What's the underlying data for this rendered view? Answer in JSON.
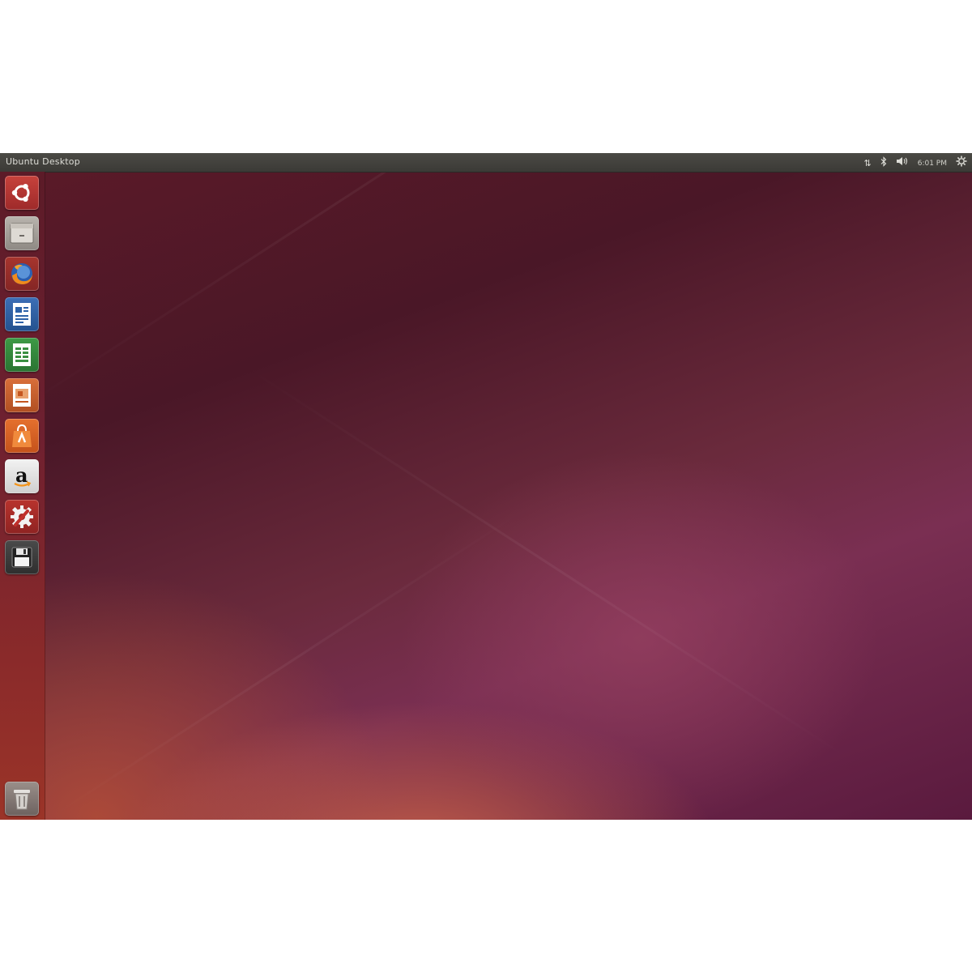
{
  "topbar": {
    "title": "Ubuntu Desktop",
    "indicators": {
      "network_icon": "network-arrows-icon",
      "bluetooth_icon": "bluetooth-icon",
      "volume_icon": "volume-icon",
      "clock": "6:01 PM",
      "session_icon": "gear-power-icon"
    }
  },
  "launcher": {
    "items": [
      {
        "name": "dash-home",
        "icon": "ubuntu-logo-icon"
      },
      {
        "name": "files",
        "icon": "file-manager-icon"
      },
      {
        "name": "firefox",
        "icon": "firefox-icon"
      },
      {
        "name": "libreoffice-writer",
        "icon": "writer-document-icon"
      },
      {
        "name": "libreoffice-calc",
        "icon": "calc-spreadsheet-icon"
      },
      {
        "name": "libreoffice-impress",
        "icon": "impress-presentation-icon"
      },
      {
        "name": "software-center",
        "icon": "shopping-bag-icon"
      },
      {
        "name": "amazon",
        "icon": "amazon-icon"
      },
      {
        "name": "system-settings",
        "icon": "settings-wrench-gear-icon"
      },
      {
        "name": "removable-drive",
        "icon": "floppy-drive-icon"
      },
      {
        "name": "trash",
        "icon": "trash-icon"
      }
    ],
    "amazon_letter": "a"
  },
  "colors": {
    "topbar": "#3f3e3a",
    "launcher_top": "#5c1b28",
    "launcher_bottom": "#9b3428",
    "wallpaper_dark": "#4a1727",
    "wallpaper_orange": "#cd6446",
    "wallpaper_purple": "#7a2f52"
  }
}
